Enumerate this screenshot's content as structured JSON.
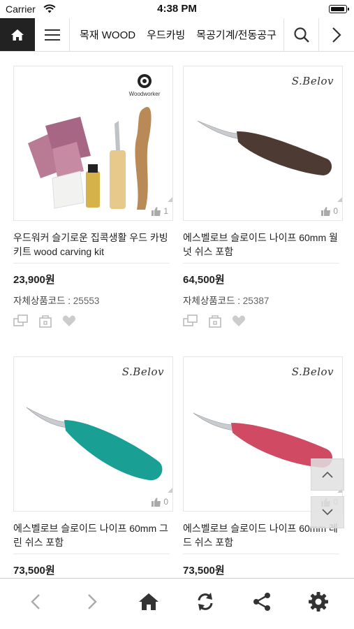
{
  "status_bar": {
    "carrier": "Carrier",
    "time": "4:38 PM"
  },
  "top_nav": {
    "categories": [
      "목재 WOOD",
      "우드카빙",
      "목공기계/전동공구"
    ]
  },
  "products": [
    {
      "brand": "Woodworker",
      "title": "우드워커 슬기로운 집콕생활 우드 카빙 키트 wood carving kit",
      "price": "23,900원",
      "code_label": "자체상품코드 :",
      "code": "25553",
      "likes": "1",
      "knife_color": "#5a3e2d"
    },
    {
      "brand": "S.Belov",
      "title": "에스벨로브 슬로이드 나이프 60mm 월넛 쉬스 포함",
      "price": "64,500원",
      "code_label": "자체상품코드 :",
      "code": "25387",
      "likes": "0",
      "knife_color": "#4d3a33"
    },
    {
      "brand": "S.Belov",
      "title": "에스벨로브 슬로이드 나이프 60mm 그린 쉬스 포함",
      "price": "73,500원",
      "likes": "0",
      "knife_color": "#1a9f94"
    },
    {
      "brand": "S.Belov",
      "title": "에스벨로브 슬로이드 나이프 60mm 레드 쉬스 포함",
      "price": "73,500원",
      "likes": "0",
      "knife_color": "#d14a63"
    }
  ]
}
